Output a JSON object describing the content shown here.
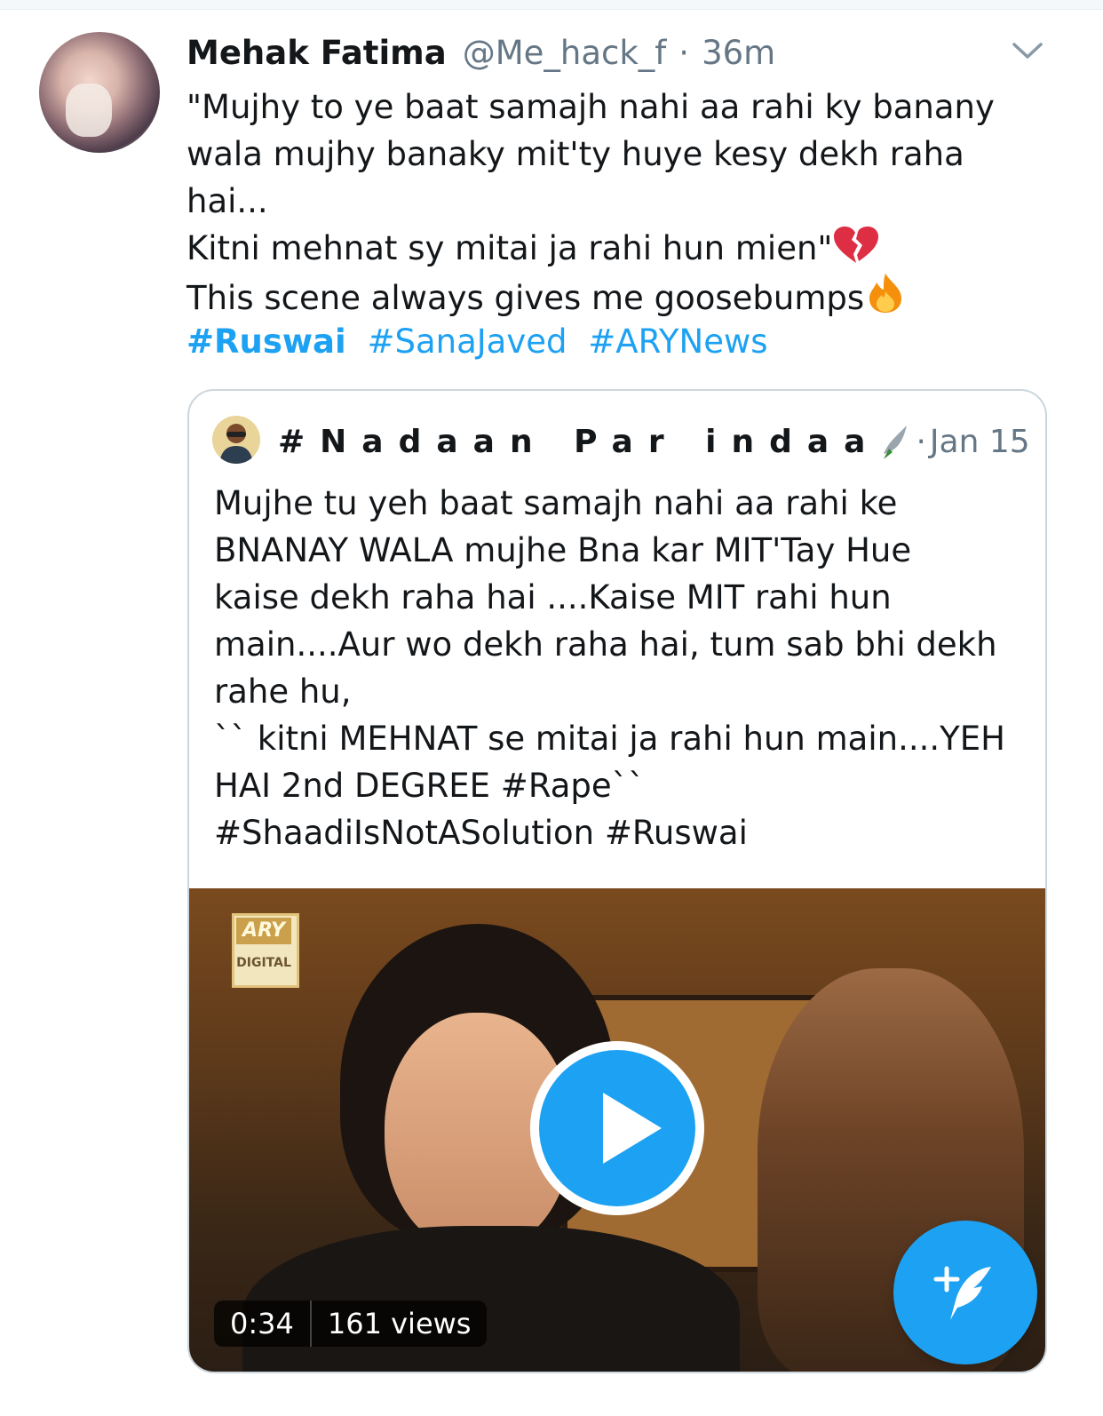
{
  "tweet": {
    "author_name": "Mehak Fatima",
    "author_handle": "@Me_hack_f",
    "separator": "·",
    "time": "36m",
    "lines": [
      "\"Mujhy to ye baat samajh nahi aa rahi ky banany",
      "wala mujhy banaky mit'ty huye kesy dekh raha",
      "hai...",
      "Kitni mehnat sy mitai ja rahi hun mien\"",
      "This scene always gives me goosebumps"
    ],
    "emojis": [
      "broken-heart-emoji",
      "fire-emoji"
    ],
    "hashtags": [
      "#Ruswai",
      "#SanaJaved",
      "#ARYNews"
    ]
  },
  "quote": {
    "author_name": "#Nadaan Par indaa",
    "separator": "·",
    "date": "Jan 15",
    "lines": [
      "Mujhe tu yeh baat samajh nahi aa rahi ke",
      "BNANAY WALA mujhe Bna kar MIT'Tay Hue",
      "kaise dekh raha hai ....Kaise MIT rahi hun",
      "main....Aur wo dekh raha hai, tum sab bhi dekh",
      "rahe hu,",
      "`` kitni MEHNAT se mitai ja rahi hun main....YEH",
      "HAI 2nd DEGREE #Rape``",
      "#ShaadiIsNotASolution #Ruswai"
    ],
    "video": {
      "duration": "0:34",
      "views": "161 views",
      "logo_top": "ARY",
      "logo_bottom": "DIGITAL"
    }
  },
  "colors": {
    "accent": "#1da1f2",
    "text": "#14171a",
    "secondary": "#657786",
    "border": "#ccd6dd"
  },
  "icons": [
    "chevron-down-icon",
    "play-icon",
    "compose-tweet-icon"
  ]
}
